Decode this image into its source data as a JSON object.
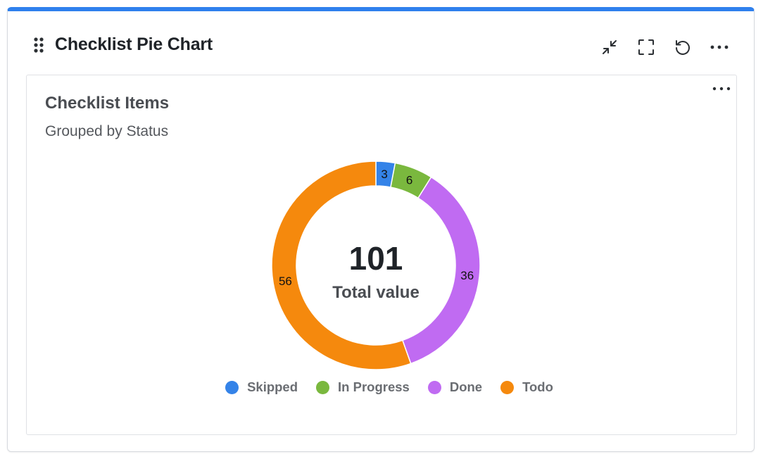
{
  "widget": {
    "title": "Checklist Pie Chart",
    "accent_color": "#2f80ed",
    "actions": [
      "collapse-icon",
      "fullscreen-icon",
      "refresh-icon",
      "more-icon"
    ]
  },
  "card": {
    "menu_icon": "more-horizontal-icon"
  },
  "chart_data": {
    "type": "pie",
    "variant": "donut",
    "title": "Checklist Items",
    "subtitle": "Grouped by Status",
    "center_value": "101",
    "center_label": "Total value",
    "legend_position": "bottom",
    "slices": [
      {
        "label": "Skipped",
        "value": 3,
        "color": "#3483e8"
      },
      {
        "label": "In Progress",
        "value": 6,
        "color": "#7ab83e"
      },
      {
        "label": "Done",
        "value": 36,
        "color": "#c06bf2"
      },
      {
        "label": "Todo",
        "value": 56,
        "color": "#f5890d"
      }
    ]
  }
}
